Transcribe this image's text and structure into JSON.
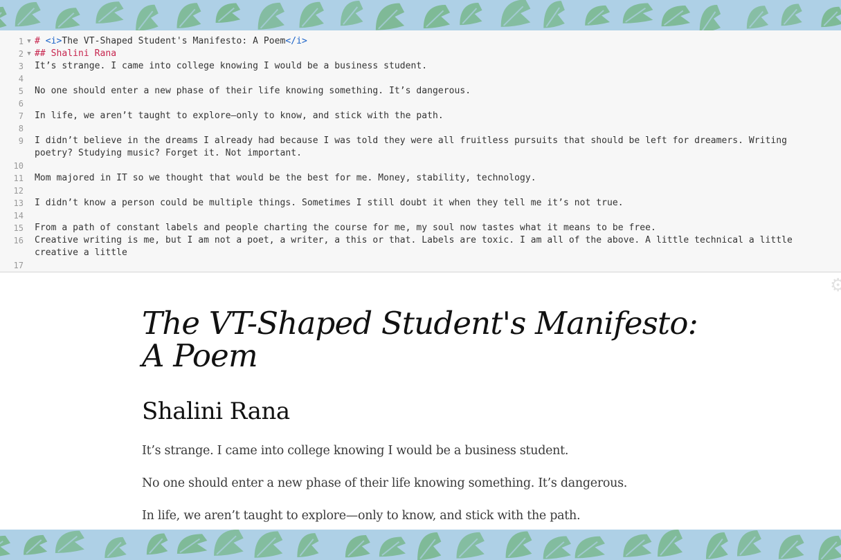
{
  "colors": {
    "banner_bg": "#aed0e6",
    "banner_leaf": "#7db995",
    "editor_bg": "#f7f7f7",
    "markdown_heading": "#c7254e",
    "markdown_tag": "#1a62c8"
  },
  "editor": {
    "fold_marker": "▼",
    "lines": [
      {
        "num": "1",
        "fold": true,
        "prefix": "# ",
        "tag_open": "<i>",
        "text": "The VT-Shaped Student's Manifesto: A Poem",
        "tag_close": "</i>"
      },
      {
        "num": "2",
        "fold": true,
        "prefix": "## ",
        "text": "Shalini Rana"
      },
      {
        "num": "3",
        "text": "It’s strange. I came into college knowing I would be a business student."
      },
      {
        "num": "4",
        "text": ""
      },
      {
        "num": "5",
        "text": "No one should enter a new phase of their life knowing something. It’s dangerous."
      },
      {
        "num": "6",
        "text": ""
      },
      {
        "num": "7",
        "text": "In life, we aren’t taught to explore—only to know, and stick with the path."
      },
      {
        "num": "8",
        "text": ""
      },
      {
        "num": "9",
        "text": "I didn’t believe in the dreams I already had because I was told they were all fruitless pursuits that should be left for dreamers. Writing poetry? Studying music? Forget it. Not important."
      },
      {
        "num": "10",
        "text": ""
      },
      {
        "num": "11",
        "text": "Mom majored in IT so we thought that would be the best for me. Money, stability, technology."
      },
      {
        "num": "12",
        "text": ""
      },
      {
        "num": "13",
        "text": "I didn’t know a person could be multiple things. Sometimes I still doubt it when they tell me it’s not true."
      },
      {
        "num": "14",
        "text": ""
      },
      {
        "num": "15",
        "text": "From a path of constant labels and people charting the course for me, my soul now tastes what it means to be free."
      },
      {
        "num": "16",
        "text": "Creative writing is me, but I am not a poet, a writer, a this or that. Labels are toxic. I am all of the above. A little technical a little creative a little"
      },
      {
        "num": "17",
        "text": ""
      }
    ]
  },
  "preview": {
    "settings_icon": "gear-icon",
    "title": "The VT-Shaped Student's Manifesto: A Poem",
    "author": "Shalini Rana",
    "paragraphs": [
      "It’s strange. I came into college knowing I would be a business student.",
      "No one should enter a new phase of their life knowing something. It’s dangerous.",
      "In life, we aren’t taught to explore—only to know, and stick with the path."
    ]
  }
}
